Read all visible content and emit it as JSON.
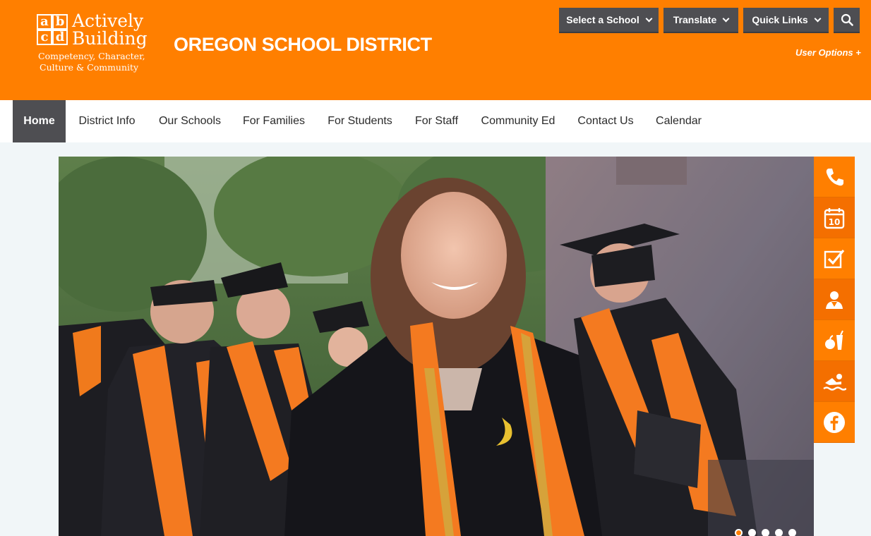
{
  "header": {
    "logo": {
      "word1": "Actively",
      "word2": "Building",
      "tagline1": "Competency, Character,",
      "tagline2": "Culture & Community"
    },
    "site_title": "OREGON SCHOOL DISTRICT",
    "buttons": {
      "select_school": "Select a School",
      "translate": "Translate",
      "quick_links": "Quick Links"
    },
    "user_options": "User Options +"
  },
  "nav": {
    "items": [
      {
        "label": "Home",
        "active": true
      },
      {
        "label": "District Info"
      },
      {
        "label": "Our Schools"
      },
      {
        "label": "For Families"
      },
      {
        "label": "For Students"
      },
      {
        "label": "For Staff"
      },
      {
        "label": "Community Ed"
      },
      {
        "label": "Contact Us"
      },
      {
        "label": "Calendar"
      }
    ]
  },
  "hero": {
    "slide_count": 5,
    "active_slide": 1
  },
  "sidebar": {
    "icons": [
      "phone-icon",
      "calendar-icon",
      "checklist-icon",
      "staff-icon",
      "lunch-icon",
      "swimmer-icon",
      "facebook-icon"
    ],
    "calendar_day": "10"
  },
  "colors": {
    "brand_orange": "#ff7f00",
    "button_gray": "#4e4e52"
  }
}
